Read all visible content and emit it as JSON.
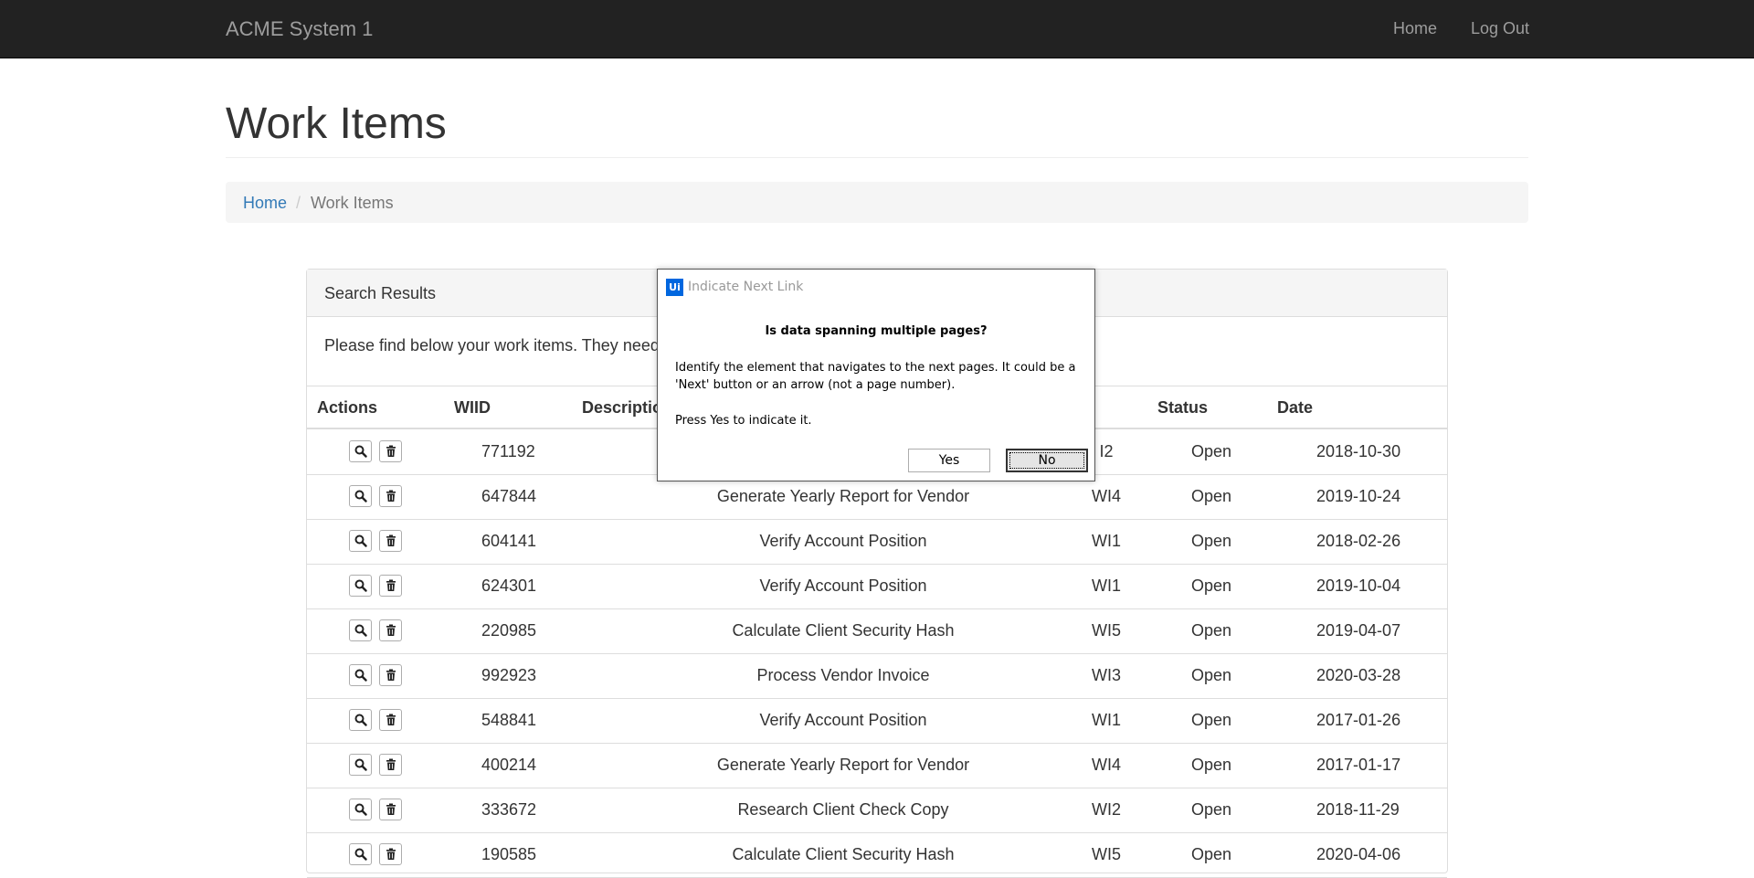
{
  "navbar": {
    "brand": "ACME System 1",
    "links": {
      "home": "Home",
      "logout": "Log Out"
    }
  },
  "page": {
    "title": "Work Items"
  },
  "breadcrumb": {
    "home": "Home",
    "separator": "/",
    "current": "Work Items"
  },
  "panel": {
    "heading": "Search Results",
    "intro": "Please find below your work items. They need t",
    "columns": {
      "actions": "Actions",
      "wiid": "WIID",
      "description": "Descriptio",
      "status": "Status",
      "date": "Date"
    },
    "rows": [
      {
        "wiid": "771192",
        "description": "",
        "type": "I2",
        "status": "Open",
        "date": "2018-10-30"
      },
      {
        "wiid": "647844",
        "description": "Generate Yearly Report for Vendor",
        "type": "WI4",
        "status": "Open",
        "date": "2019-10-24"
      },
      {
        "wiid": "604141",
        "description": "Verify Account Position",
        "type": "WI1",
        "status": "Open",
        "date": "2018-02-26"
      },
      {
        "wiid": "624301",
        "description": "Verify Account Position",
        "type": "WI1",
        "status": "Open",
        "date": "2019-10-04"
      },
      {
        "wiid": "220985",
        "description": "Calculate Client Security Hash",
        "type": "WI5",
        "status": "Open",
        "date": "2019-04-07"
      },
      {
        "wiid": "992923",
        "description": "Process Vendor Invoice",
        "type": "WI3",
        "status": "Open",
        "date": "2020-03-28"
      },
      {
        "wiid": "548841",
        "description": "Verify Account Position",
        "type": "WI1",
        "status": "Open",
        "date": "2017-01-26"
      },
      {
        "wiid": "400214",
        "description": "Generate Yearly Report for Vendor",
        "type": "WI4",
        "status": "Open",
        "date": "2017-01-17"
      },
      {
        "wiid": "333672",
        "description": "Research Client Check Copy",
        "type": "WI2",
        "status": "Open",
        "date": "2018-11-29"
      },
      {
        "wiid": "190585",
        "description": "Calculate Client Security Hash",
        "type": "WI5",
        "status": "Open",
        "date": "2020-04-06"
      }
    ]
  },
  "dialog": {
    "logo": "Ui",
    "title": "Indicate Next Link",
    "question": "Is data spanning multiple pages?",
    "body": "Identify the element that navigates to the next pages. It could be a 'Next' button or an arrow (not a page number).",
    "instruction": "Press Yes to indicate it.",
    "yes_label": "Yes",
    "no_label": "No"
  },
  "icons": {
    "view": "magnifier-icon",
    "delete": "trash-icon"
  }
}
